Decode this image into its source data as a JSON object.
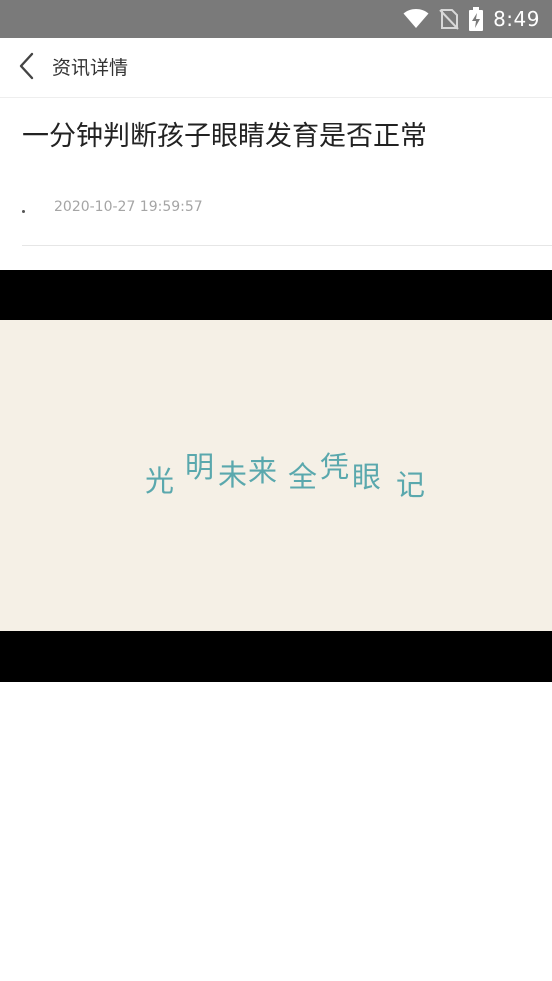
{
  "status_bar": {
    "time": "8:49",
    "icons": [
      "wifi-icon",
      "no-sim-icon",
      "battery-charging-icon"
    ]
  },
  "header": {
    "back_icon": "chevron-left-icon",
    "title": "资讯详情"
  },
  "article": {
    "title": "一分钟判断孩子眼睛发育是否正常",
    "author": "",
    "publish_time": "2020-10-27 19:59:57"
  },
  "media": {
    "slogan_chars": [
      "光",
      "明",
      "未",
      "来",
      "全",
      "凭",
      "眼",
      "记"
    ],
    "colors": {
      "background": "#f5f0e6",
      "text": "#5aa8ad",
      "letterbox": "#000000"
    }
  }
}
